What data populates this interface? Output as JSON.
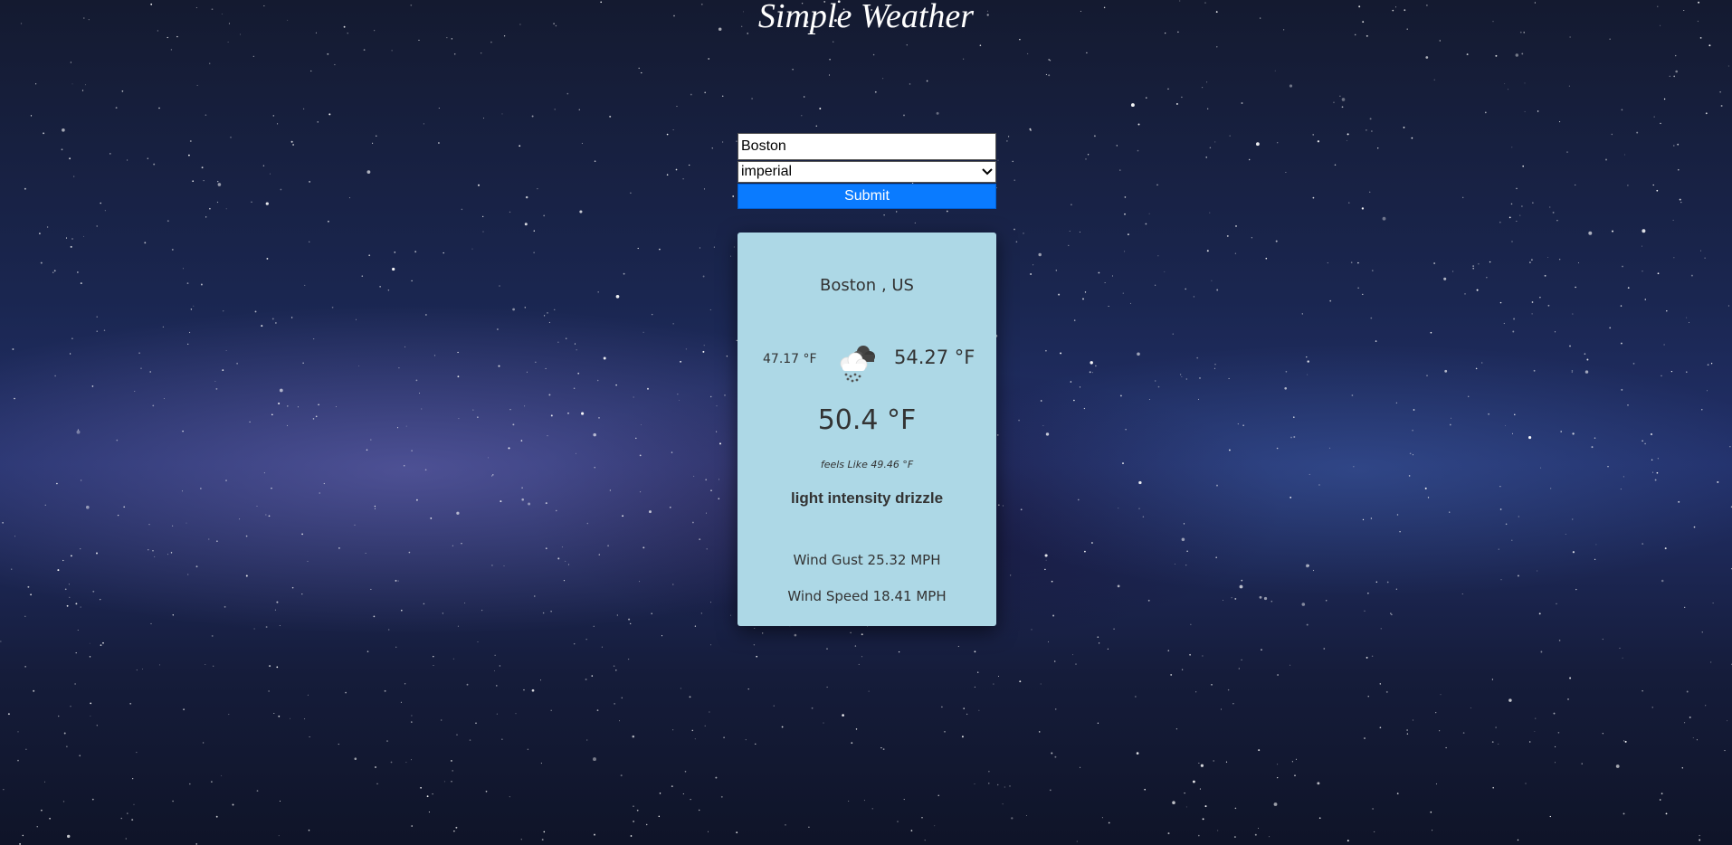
{
  "app": {
    "title": "Simple Weather"
  },
  "form": {
    "city_value": "Boston",
    "units_selected": "imperial",
    "submit_label": "Submit",
    "submit_color": "#0a7bff"
  },
  "card": {
    "location": "Boston , US",
    "temp_min": "47.17 °F",
    "temp_max": "54.27 °F",
    "temp_current": "50.4 °F",
    "feels_like": "feels Like 49.46 °F",
    "description": "light intensity drizzle",
    "wind_gust": "Wind Gust 25.32 MPH",
    "wind_speed": "Wind Speed 18.41 MPH",
    "icon": "cloud-drizzle-icon",
    "background_color": "#add8e6"
  }
}
